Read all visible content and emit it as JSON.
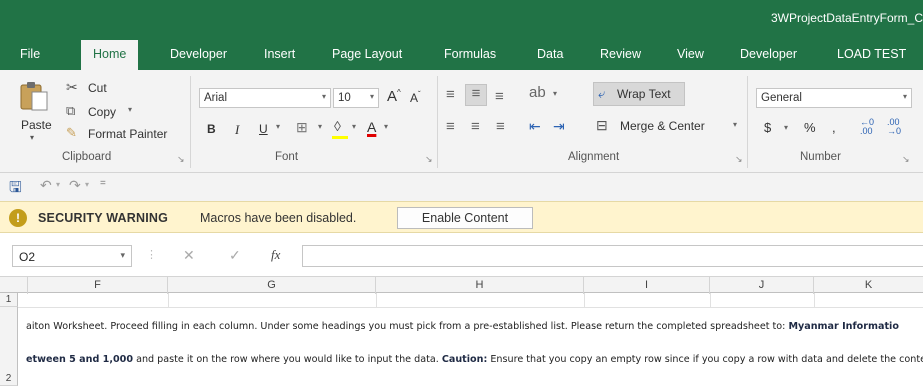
{
  "title": "3WProjectDataEntryForm_C",
  "tabs": [
    "File",
    "Home",
    "Developer",
    "Insert",
    "Page Layout",
    "Formulas",
    "Data",
    "Review",
    "View",
    "Developer",
    "LOAD TEST"
  ],
  "ribbon": {
    "clipboard": {
      "paste": "Paste",
      "cut": "Cut",
      "copy": "Copy",
      "format_painter": "Format Painter",
      "label": "Clipboard"
    },
    "font": {
      "name": "Arial",
      "size": "10",
      "bold": "B",
      "italic": "I",
      "underline": "U",
      "label": "Font"
    },
    "alignment": {
      "wrap_text": "Wrap Text",
      "merge_center": "Merge & Center",
      "label": "Alignment"
    },
    "number": {
      "format": "General",
      "currency": "$",
      "percent": "%",
      "comma": ",",
      "label": "Number"
    }
  },
  "security_bar": {
    "title": "SECURITY WARNING",
    "message": "Macros have been disabled.",
    "button": "Enable Content"
  },
  "formula_bar": {
    "name_box": "O2",
    "fx": "fx",
    "value": ""
  },
  "grid": {
    "columns": [
      "F",
      "G",
      "H",
      "I",
      "J",
      "K"
    ],
    "rows": [
      "1",
      "2"
    ],
    "line1_a": "aiton Worksheet. Proceed filling in each column. Under some headings you must pick from a pre-established list. Please return the completed spreadsheet to: ",
    "line1_b": "Myanmar Informatio",
    "line2_a": "etween 5 and 1,000",
    "line2_b": " and paste it on the row where you would like to input the data. ",
    "line2_c": "Caution:",
    "line2_d": " Ensure that you copy an empty row since if you copy a row with data and delete the conten"
  },
  "colors": {
    "excel_green": "#217346",
    "ribbon_bg": "#f3f3f3",
    "warning_bg": "#fff4ce"
  }
}
